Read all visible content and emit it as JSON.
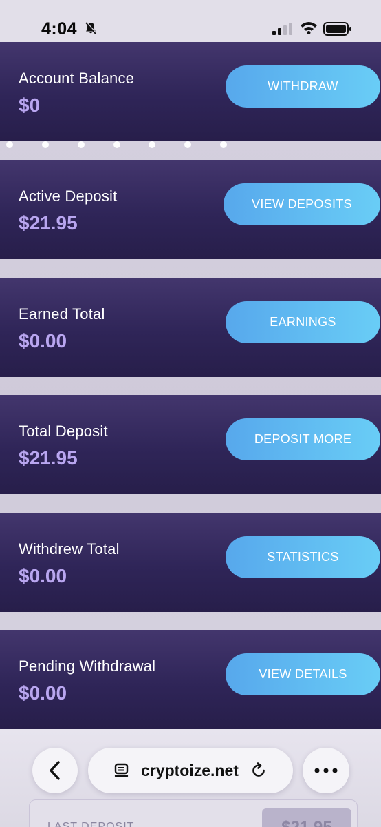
{
  "status_bar": {
    "time": "4:04"
  },
  "cards": [
    {
      "label": "Account Balance",
      "value": "$0",
      "button": "WITHDRAW"
    },
    {
      "label": "Active Deposit",
      "value": "$21.95",
      "button": "VIEW DEPOSITS"
    },
    {
      "label": "Earned Total",
      "value": "$0.00",
      "button": "EARNINGS"
    },
    {
      "label": "Total Deposit",
      "value": "$21.95",
      "button": "DEPOSIT MORE"
    },
    {
      "label": "Withdrew Total",
      "value": "$0.00",
      "button": "STATISTICS"
    },
    {
      "label": "Pending Withdrawal",
      "value": "$0.00",
      "button": "VIEW DETAILS"
    }
  ],
  "browser": {
    "url": "cryptoize.net"
  },
  "last_deposit": {
    "label": "LAST DEPOSIT",
    "value": "$21.95"
  },
  "colors": {
    "card_bg": "#2f2558",
    "value_text": "#b9a6f0",
    "button_start": "#57a8ec",
    "button_end": "#69cdf6"
  },
  "icons": [
    "bell-slash-icon",
    "signal-icon",
    "wifi-icon",
    "battery-icon",
    "back-icon",
    "tabs-icon",
    "reload-icon",
    "more-icon"
  ]
}
